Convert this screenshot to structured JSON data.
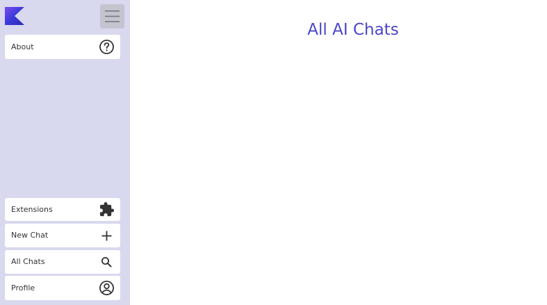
{
  "sidebar": {
    "logo_icon": "kotlin-logo-icon",
    "menu_icon": "hamburger-menu-icon",
    "items": [
      {
        "label": "About",
        "icon": "help-circle-icon"
      },
      {
        "label": "Extensions",
        "icon": "puzzle-icon"
      },
      {
        "label": "New Chat",
        "icon": "plus-icon"
      },
      {
        "label": "All Chats",
        "icon": "search-icon"
      },
      {
        "label": "Profile",
        "icon": "account-circle-icon"
      }
    ]
  },
  "main": {
    "title": "All AI Chats"
  },
  "colors": {
    "sidebar_bg": "#d8d8ee",
    "accent": "#4c46c8",
    "item_bg": "#ffffff"
  }
}
